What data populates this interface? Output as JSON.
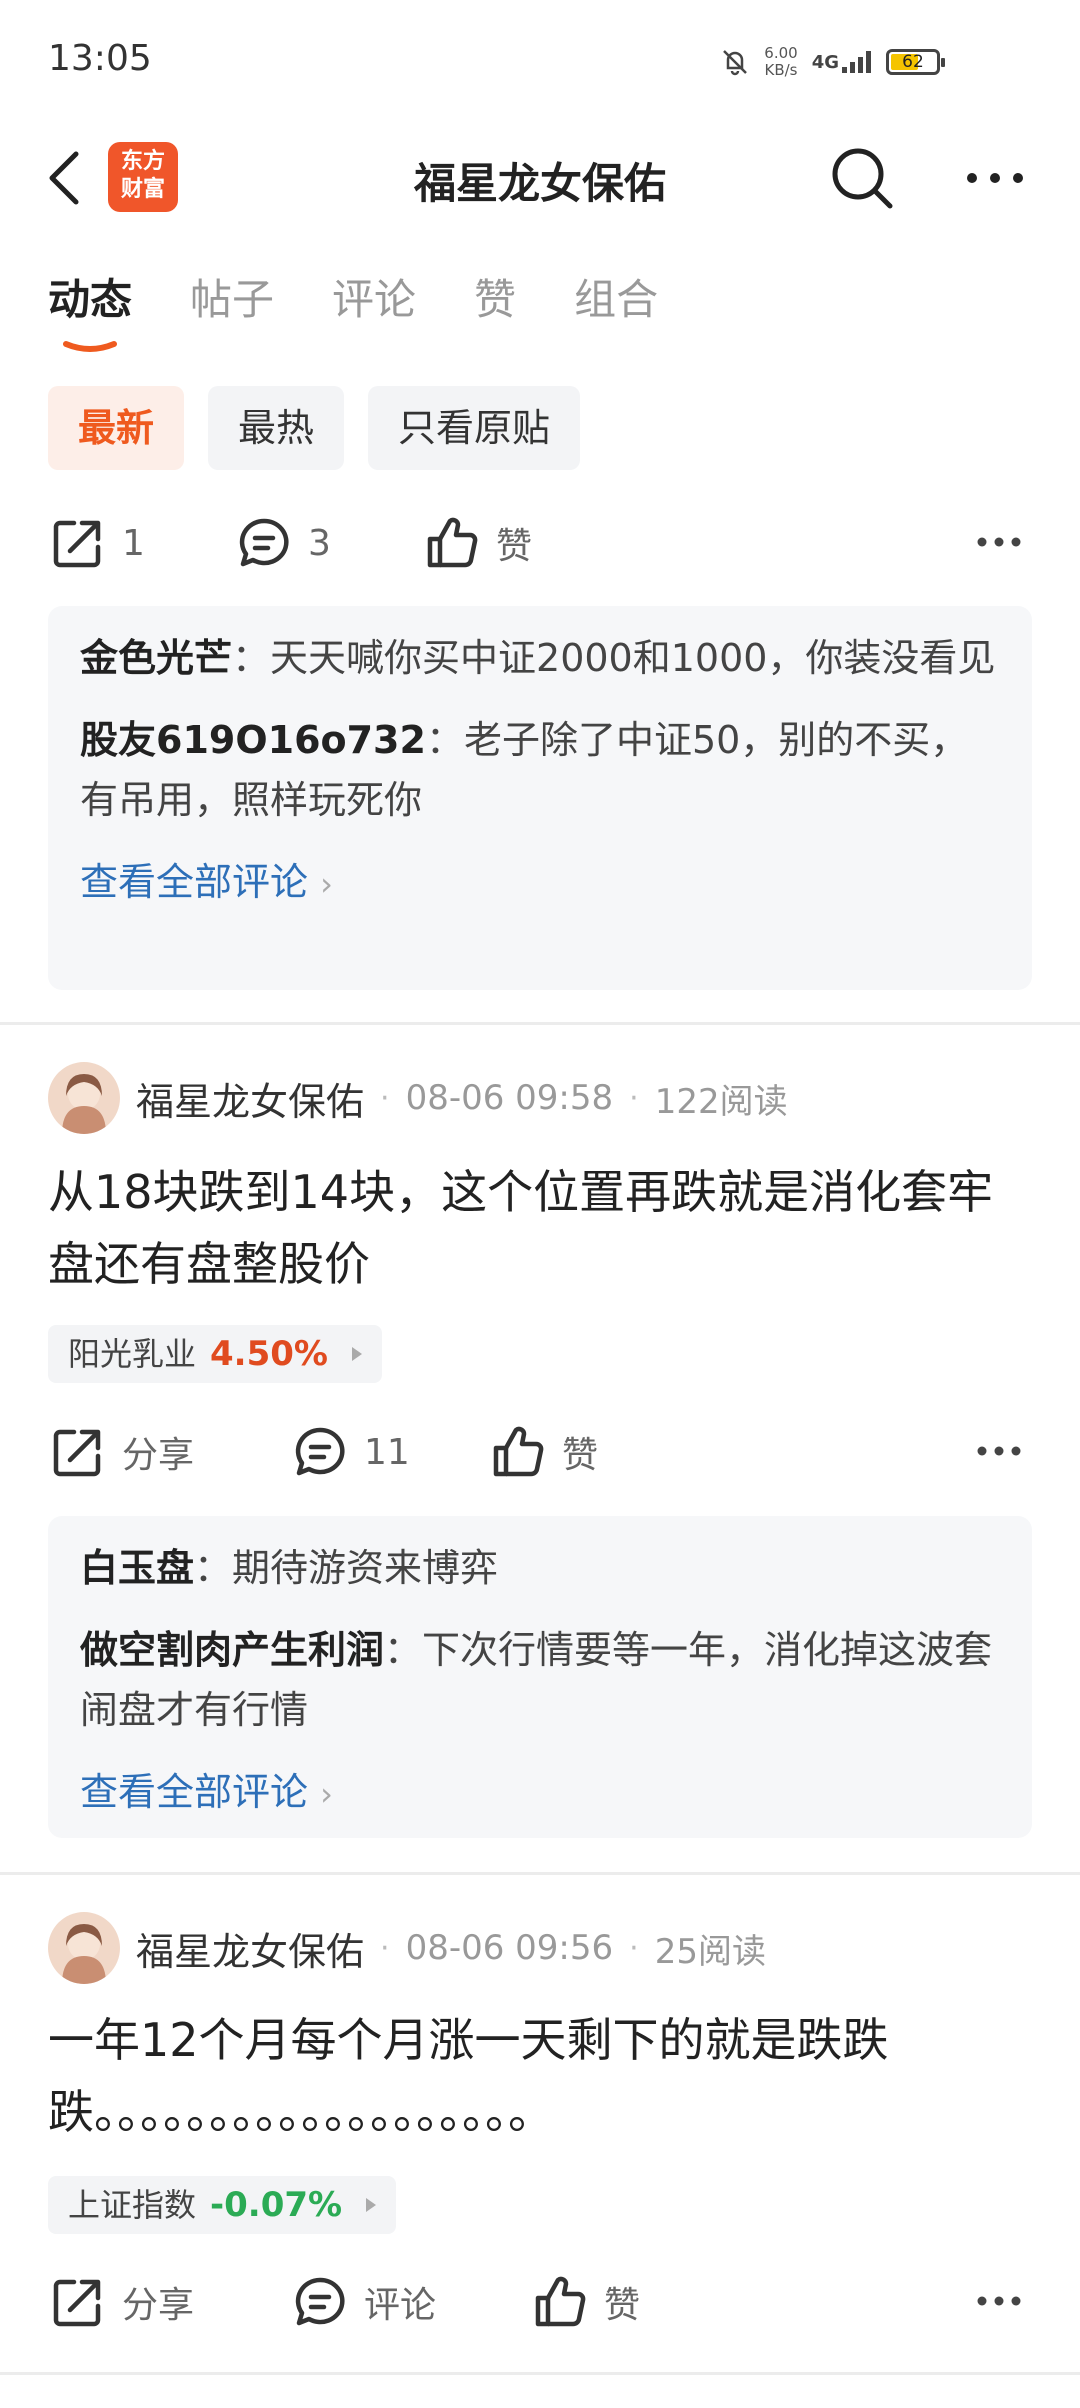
{
  "status": {
    "time": "13:05",
    "speed_value": "6.00",
    "speed_unit": "KB/s",
    "network": "4G",
    "battery": "62",
    "battery_level": 0.62
  },
  "header": {
    "logo_line1": "东方",
    "logo_line2": "财富",
    "title": "福星龙女保佑"
  },
  "tabs": [
    "动态",
    "帖子",
    "评论",
    "赞",
    "组合"
  ],
  "filters": [
    "最新",
    "最热",
    "只看原贴"
  ],
  "colors": {
    "accent": "#ef5a1f",
    "link": "#2d6fb8",
    "up": "#e04b1f",
    "down": "#2bab55"
  },
  "post0": {
    "share_label": "1",
    "comment_label": "3",
    "like_label": "赞",
    "comments": [
      {
        "user": "金色光芒",
        "text": "：天天喊你买中证2000和1000，你装没看见"
      },
      {
        "user": "股友619O16o732",
        "text": "：老子除了中证50，别的不买，有吊用，照样玩死你"
      }
    ],
    "view_all": "查看全部评论"
  },
  "post1": {
    "author": "福星龙女保佑",
    "time": "08-06 09:58",
    "reads": "122阅读",
    "body": "从18块跌到14块，这个位置再跌就是消化套牢盘还有盘整股价",
    "stock_name": "阳光乳业",
    "stock_pct": "4.50%",
    "share_label": "分享",
    "comment_label": "11",
    "like_label": "赞",
    "comments": [
      {
        "user": "白玉盘",
        "text": "：期待游资来博弈"
      },
      {
        "user": "做空割肉产生利润",
        "text": "：下次行情要等一年，消化掉这波套闹盘才有行情"
      }
    ],
    "view_all": "查看全部评论"
  },
  "post2": {
    "author": "福星龙女保佑",
    "time": "08-06 09:56",
    "reads": "25阅读",
    "body": "一年12个月每个月涨一天剩下的就是跌跌跌。。。。。。。。。。。。。。。。。。。",
    "stock_name": "上证指数",
    "stock_pct": "-0.07%",
    "share_label": "分享",
    "comment_label": "评论",
    "like_label": "赞"
  }
}
